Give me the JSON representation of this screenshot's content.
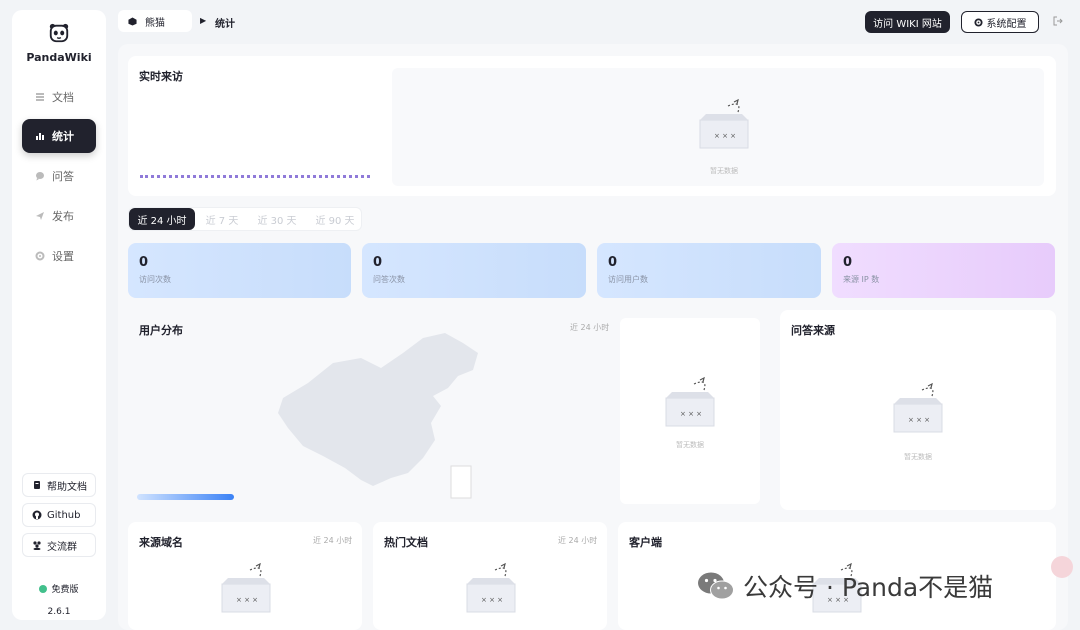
{
  "sidebar": {
    "logo_text": "PandaWiki",
    "nav": [
      {
        "label": "文档",
        "icon": "document-icon"
      },
      {
        "label": "统计",
        "icon": "chart-icon",
        "active": true
      },
      {
        "label": "问答",
        "icon": "chat-icon"
      },
      {
        "label": "发布",
        "icon": "send-icon"
      },
      {
        "label": "设置",
        "icon": "gear-icon"
      }
    ],
    "links": [
      {
        "label": "帮助文档",
        "icon": "book-icon"
      },
      {
        "label": "Github",
        "icon": "github-icon"
      },
      {
        "label": "交流群",
        "icon": "group-icon"
      }
    ],
    "plan": "免费版",
    "version": "2.6.1"
  },
  "header": {
    "workspace": "熊猫",
    "current_page": "统计",
    "visit_button": "访问 WIKI 网站",
    "config_button": "系统配置"
  },
  "realtime": {
    "title": "实时来访",
    "empty_text": "暂无数据"
  },
  "time_tabs": [
    {
      "label": "近 24 小时",
      "active": true
    },
    {
      "label": "近 7 天"
    },
    {
      "label": "近 30 天"
    },
    {
      "label": "近 90 天"
    }
  ],
  "stats": [
    {
      "value": "0",
      "label": "访问次数"
    },
    {
      "value": "0",
      "label": "问答次数"
    },
    {
      "value": "0",
      "label": "访问用户数"
    },
    {
      "value": "0",
      "label": "来源 IP 数"
    }
  ],
  "user_distribution": {
    "title": "用户分布",
    "range": "近 24 小时",
    "empty_text": "暂无数据"
  },
  "qa_source": {
    "title": "问答来源",
    "empty_text": "暂无数据"
  },
  "source_domain": {
    "title": "来源域名",
    "range": "近 24 小时"
  },
  "hot_docs": {
    "title": "热门文档",
    "range": "近 24 小时"
  },
  "client": {
    "title": "客户端"
  },
  "watermark": "公众号 · Panda不是猫",
  "colors": {
    "dark": "#21222d",
    "stat_blue": "#d5e6ff",
    "stat_purple": "#f0ddff",
    "accent": "#3b82f6",
    "free_dot": "#42c08c"
  }
}
